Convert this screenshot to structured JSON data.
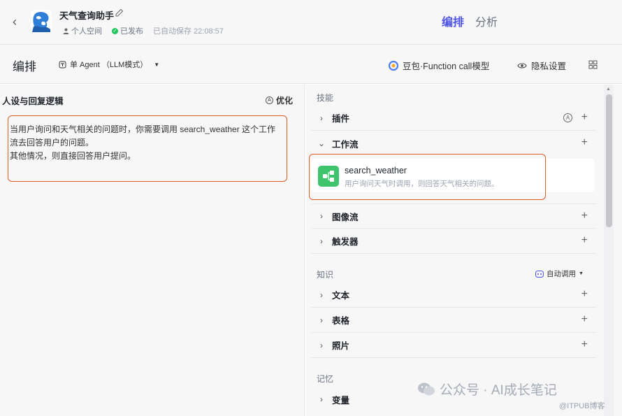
{
  "header": {
    "bot_name": "天气查询助手",
    "space": "个人空间",
    "status": "已发布",
    "autosave": "已自动保存 22:08:57",
    "tabs": [
      {
        "label": "编排",
        "active": true
      },
      {
        "label": "分析",
        "active": false
      }
    ]
  },
  "toolbar": {
    "title": "编排",
    "agent_mode": "单 Agent （LLM模式）",
    "model": "豆包·Function call模型",
    "privacy": "隐私设置"
  },
  "persona": {
    "title": "人设与回复逻辑",
    "optimize": "优化",
    "lines": [
      "当用户询问和天气相关的问题时，你需要调用 search_weather 这个工作",
      "流去回答用户的问题。",
      "其他情况，则直接回答用户提问。"
    ]
  },
  "skills": {
    "label": "技能",
    "plugin": "插件",
    "workflow": "工作流",
    "workflow_item": {
      "name": "search_weather",
      "desc": "用户询问天气时调用，则回答天气相关的问题。"
    },
    "image_flow": "图像流",
    "trigger": "触发器"
  },
  "knowledge": {
    "label": "知识",
    "auto_call": "自动调用",
    "text": "文本",
    "table": "表格",
    "photo": "照片"
  },
  "memory": {
    "label": "记忆",
    "variable": "变量"
  },
  "watermark": {
    "main": "公众号 · AI成长笔记",
    "sub": "@ITPUB博客"
  },
  "colors": {
    "accent": "#4d53e8",
    "highlight_box": "#e05a2b",
    "workflow_icon": "#3ec46d",
    "published": "#22c55e"
  }
}
